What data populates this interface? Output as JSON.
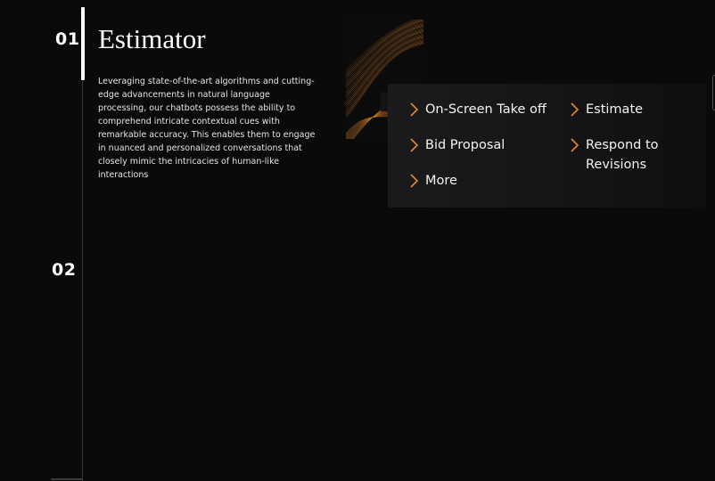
{
  "steps": [
    {
      "number": "01",
      "title": "Estimator",
      "description": "Leveraging state-of-the-art algorithms and cutting-edge advancements in natural language processing, our chatbots possess the ability to comprehend intricate contextual cues with remarkable accuracy. This enables them to engage in nuanced and personalized conversations that closely mimic the intricacies of human-like interactions"
    },
    {
      "number": "02"
    }
  ],
  "menu": {
    "items": [
      {
        "label": "On-Screen Take off",
        "icon": "chevron-right-icon"
      },
      {
        "label": "Estimate",
        "icon": "chevron-right-icon"
      },
      {
        "label": "Bid Proposal",
        "icon": "chevron-right-icon"
      },
      {
        "label": "Respond to Revisions",
        "icon": "chevron-right-icon"
      },
      {
        "label": "More",
        "icon": "chevron-right-icon"
      }
    ]
  },
  "colors": {
    "accent": "#e8892b",
    "background": "#0a0a0b",
    "panel": "#161618",
    "text": "#ffffff"
  }
}
